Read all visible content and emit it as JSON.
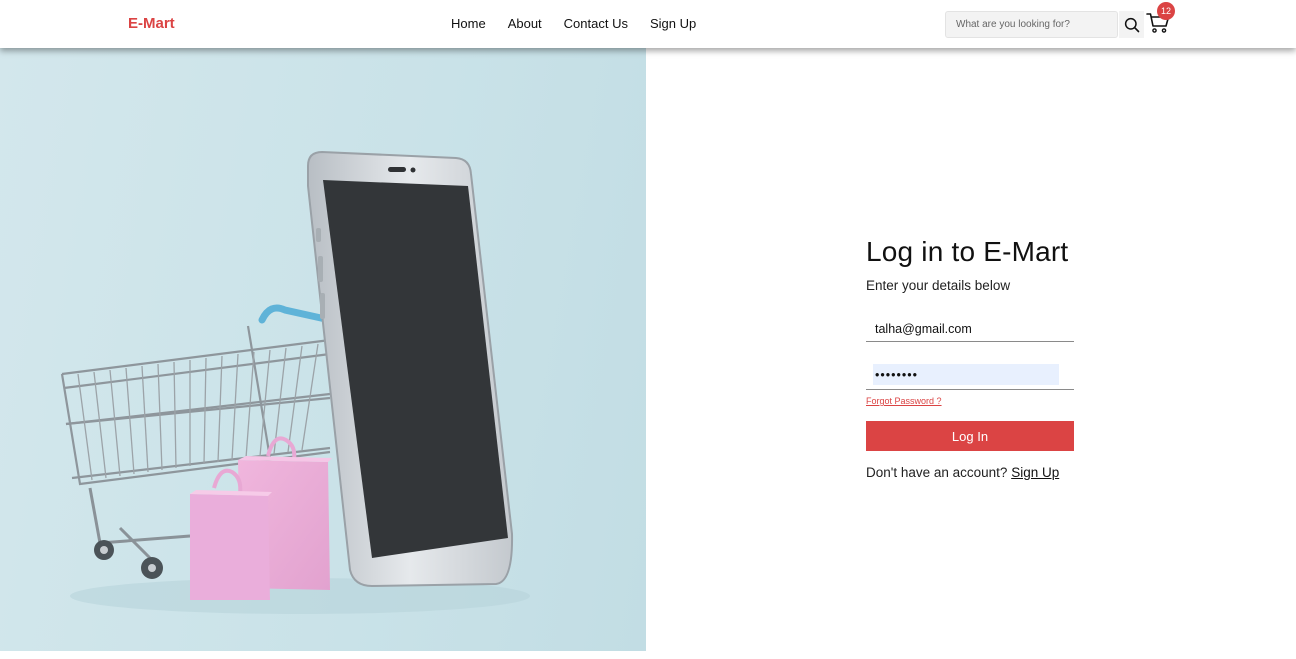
{
  "nav": {
    "brand": "E-Mart",
    "links": [
      "Home",
      "About",
      "Contact Us",
      "Sign Up"
    ],
    "search_placeholder": "What are you looking for?",
    "cart_count": "12"
  },
  "colors": {
    "accent": "#db4444",
    "autofill": "#e8f0fe",
    "hero_bg": "#c9e2e8"
  },
  "icons": {
    "search": "search-icon",
    "cart": "cart-icon"
  },
  "login": {
    "title": "Log in to E-Mart",
    "subtitle": "Enter your details below",
    "email_value": "talha@gmail.com",
    "password_value": "••••••••",
    "forgot_label": "Forgot Password ?",
    "submit_label": "Log In",
    "no_account_text": "Don't have an account? ",
    "signup_link": "Sign Up"
  }
}
